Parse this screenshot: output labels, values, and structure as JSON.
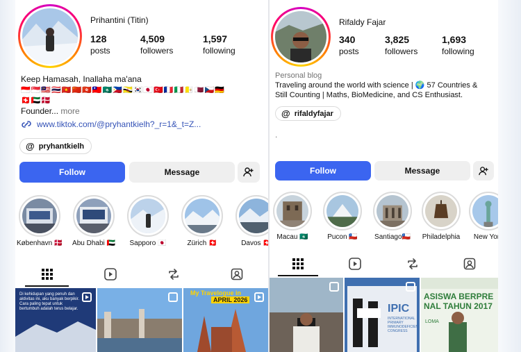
{
  "colors": {
    "follow": "#3b65f0",
    "link": "#3553b7",
    "muted": "#737373",
    "message_bg": "#efefef"
  },
  "left": {
    "username": "Prihantini (Titin)",
    "stats": [
      {
        "num": "128",
        "label": "posts"
      },
      {
        "num": "4,509",
        "label": "followers"
      },
      {
        "num": "1,597",
        "label": "following"
      }
    ],
    "bio_line": "Keep Hamasah, Inallaha ma'ana",
    "flags_row1": "🇮🇩🇸🇬🇲🇾🇹🇭🇻🇳🇨🇳🇭🇰🇹🇼🇲🇴🇵🇭🇧🇳🇰🇷🇯🇵🇹🇷🇫🇷🇮🇹🇻🇦🇶🇦🇨🇿🇩🇪",
    "flags_row2": "🇨🇭🇦🇪🇩🇰",
    "founder": "Founder...",
    "more": "more",
    "link": "www.tiktok.com/@pryhantkielh?_r=1&_t=Z...",
    "threads": "pryhantkielh",
    "follow": "Follow",
    "message": "Message",
    "highlights": [
      {
        "label": "København 🇩🇰",
        "icon": "copenhagen-icon"
      },
      {
        "label": "Abu Dhabi 🇦🇪",
        "icon": "abudhabi-icon"
      },
      {
        "label": "Sapporo 🇯🇵",
        "icon": "sapporo-icon"
      },
      {
        "label": "Zürich 🇨🇭",
        "icon": "zurich-icon"
      },
      {
        "label": "Davos 🇨🇭",
        "icon": "davos-icon"
      }
    ],
    "post_text_1": "Di kehidupan yang penuh dan aktivitas ini, aku banyak berpikir. Cara paling tepat untuk bertumbuh adalah terus belajar.",
    "post_title_3": "My Travelogue in",
    "post_date_3": "APRIL 2026"
  },
  "right": {
    "username": "Rifaldy Fajar",
    "stats": [
      {
        "num": "340",
        "label": "posts"
      },
      {
        "num": "3,825",
        "label": "followers"
      },
      {
        "num": "1,693",
        "label": "following"
      }
    ],
    "category": "Personal blog",
    "bio1": "Traveling around the world with science | 🌍 57 Countries &",
    "bio2": "Still Counting | Maths, BioMedicine, and CS Enthusiast.",
    "threads": "rifaldyfajar",
    "dot": ".",
    "follow": "Follow",
    "message": "Message",
    "highlights": [
      {
        "label": "Macau 🇲🇴",
        "icon": "macau-icon"
      },
      {
        "label": "Pucon 🇨🇱",
        "icon": "pucon-icon"
      },
      {
        "label": "Santiago🇨🇱",
        "icon": "santiago-icon"
      },
      {
        "label": "Philadelphia",
        "icon": "philadelphia-icon"
      },
      {
        "label": "New York",
        "icon": "newyork-icon"
      }
    ],
    "post_text_2": "IPIC",
    "post_text_2b": "INTERNATIONAL PRIMARY IMMUNODEFICIENCIES CONGRESS",
    "post_text_3": "ASISWA BERPRE NAL TAHUN 2017",
    "post_text_3b": "LOMA"
  }
}
